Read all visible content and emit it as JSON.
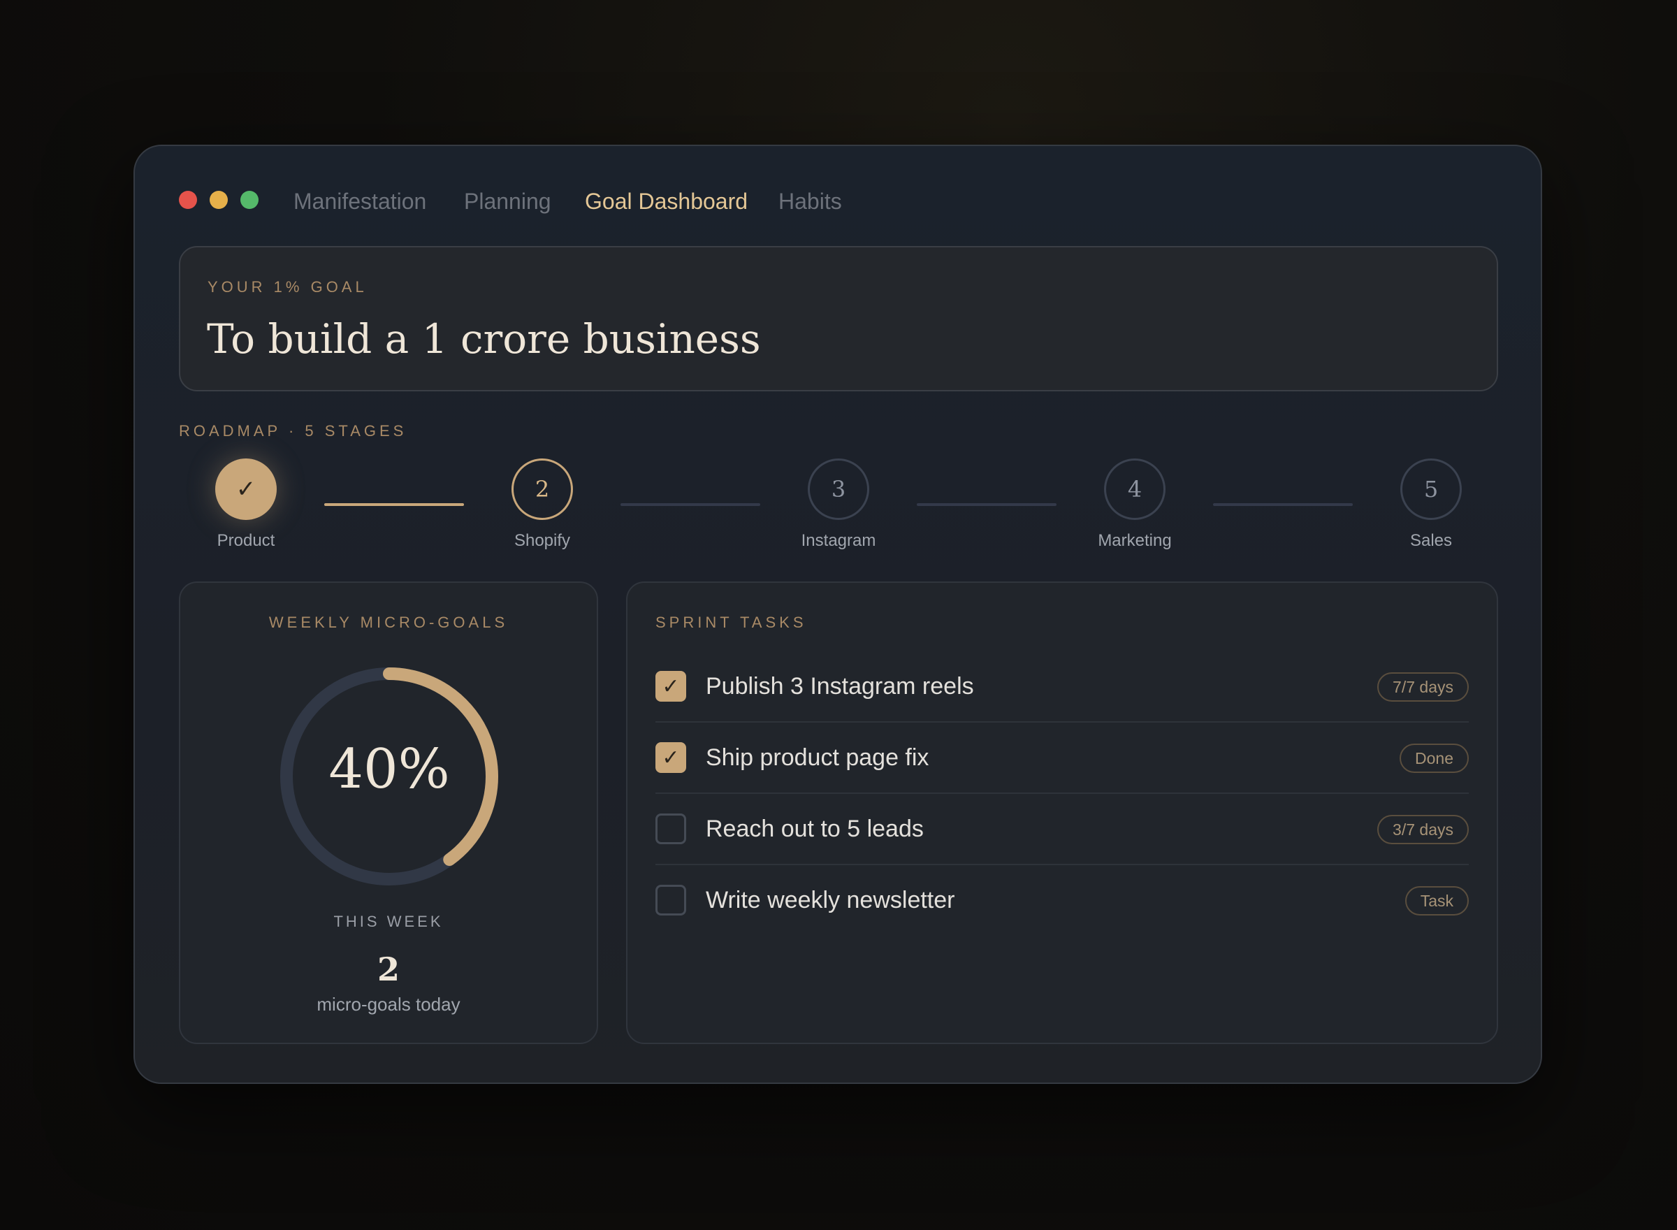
{
  "nav": {
    "tabs": [
      {
        "label": "Manifestation"
      },
      {
        "label": "Planning"
      },
      {
        "label": "Goal Dashboard"
      },
      {
        "label": "Habits"
      }
    ],
    "active_tab": "Goal Dashboard"
  },
  "goal": {
    "eyebrow": "YOUR 1% GOAL",
    "title": "To build a 1 crore business"
  },
  "roadmap": {
    "heading": "ROADMAP · 5 STAGES",
    "stages": [
      {
        "label": "Product",
        "marker": "✓",
        "status": "done"
      },
      {
        "label": "Shopify",
        "marker": "2",
        "status": "current"
      },
      {
        "label": "Instagram",
        "marker": "3",
        "status": "upcoming"
      },
      {
        "label": "Marketing",
        "marker": "4",
        "status": "upcoming"
      },
      {
        "label": "Sales",
        "marker": "5",
        "status": "upcoming"
      }
    ]
  },
  "weekly": {
    "heading": "WEEKLY MICRO-GOALS",
    "percent_label": "40%",
    "progress": 0.4,
    "period_label": "THIS WEEK",
    "count": "2",
    "count_label": "micro-goals today"
  },
  "sprint": {
    "heading": "SPRINT TASKS",
    "tasks": [
      {
        "text": "Publish 3 Instagram reels",
        "badge": "7/7 days",
        "checked": true,
        "check_glyph": "✓"
      },
      {
        "text": "Ship product page fix",
        "badge": "Done",
        "checked": true,
        "check_glyph": "✓"
      },
      {
        "text": "Reach out to 5 leads",
        "badge": "3/7 days",
        "checked": false,
        "check_glyph": ""
      },
      {
        "text": "Write weekly newsletter",
        "badge": "Task",
        "checked": false,
        "check_glyph": ""
      }
    ]
  },
  "colors": {
    "accent": "#c9a77a",
    "background": "#0f0e0c",
    "window": "#1c2129",
    "ring_track": "#313846"
  }
}
